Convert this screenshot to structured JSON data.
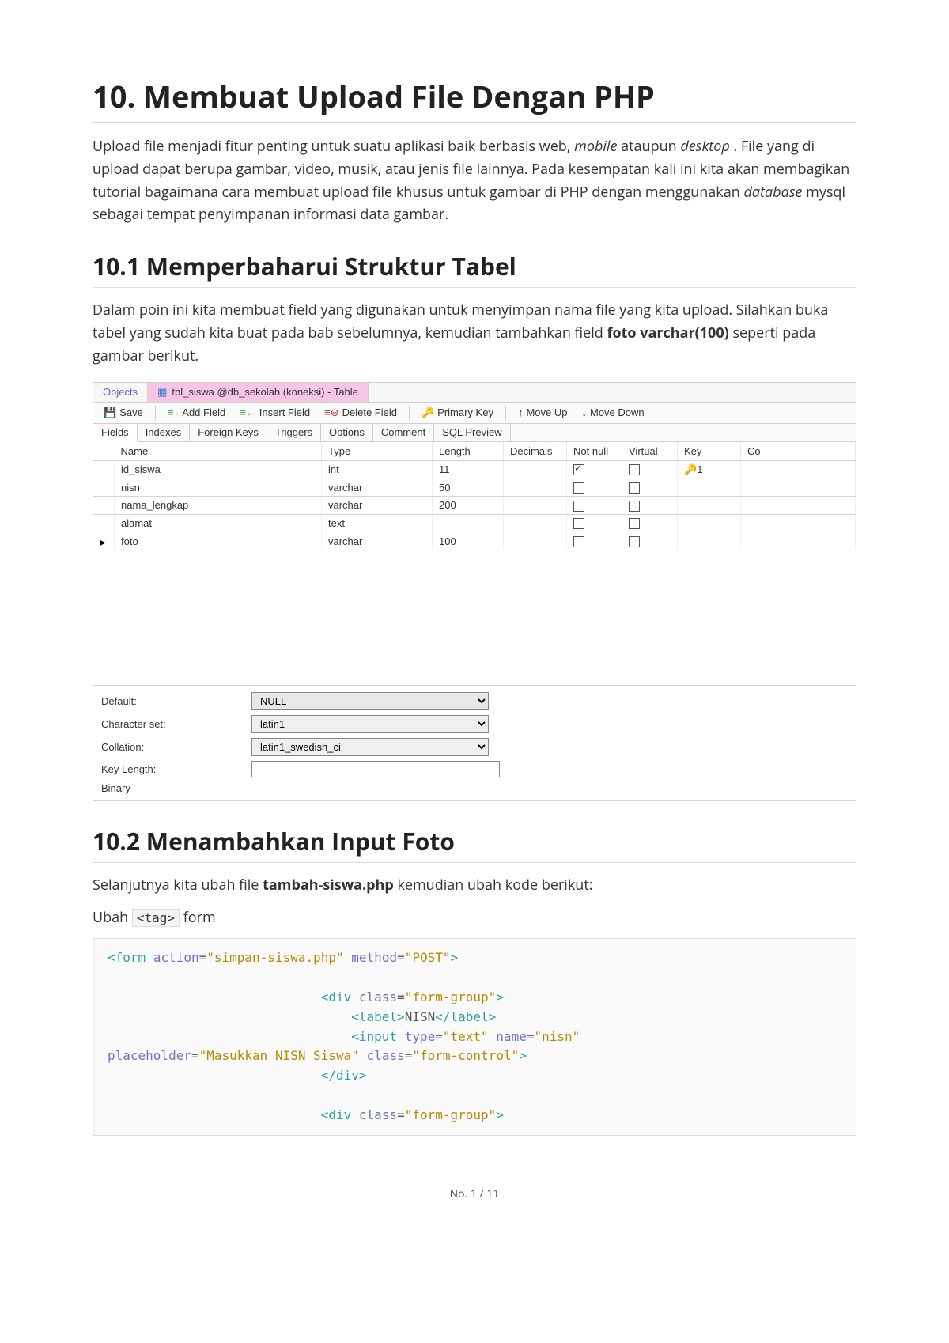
{
  "title": "10. Membuat Upload File Dengan PHP",
  "intro_chunks": [
    "Upload file menjadi fitur penting untuk suatu aplikasi baik berbasis web, ",
    "mobile",
    " ataupun ",
    "desktop",
    ". File yang di upload dapat berupa gambar, video, musik, atau jenis file lainnya. Pada kesempatan kali ini kita akan membagikan tutorial bagaimana cara membuat upload file khusus untuk gambar di PHP dengan menggunakan ",
    "database",
    " mysql sebagai tempat penyimpanan informasi data gambar."
  ],
  "sec1": {
    "title": "10.1 Memperbaharui Struktur Tabel",
    "para_a": "Dalam poin ini kita membuat field yang digunakan untuk menyimpan nama file yang kita upload. Silahkan buka tabel yang sudah kita buat pada bab sebelumnya, kemudian tambahkan field ",
    "bold": "foto varchar(100)",
    "para_b": " seperti pada gambar berikut."
  },
  "editor": {
    "tab_objects": "Objects",
    "tab_active": "tbl_siswa @db_sekolah (koneksi) - Table",
    "toolbar": {
      "save": "Save",
      "add": "Add Field",
      "insert": "Insert Field",
      "delete": "Delete Field",
      "pk": "Primary Key",
      "up": "Move Up",
      "down": "Move Down"
    },
    "subtabs": [
      "Fields",
      "Indexes",
      "Foreign Keys",
      "Triggers",
      "Options",
      "Comment",
      "SQL Preview"
    ],
    "columns": [
      "Name",
      "Type",
      "Length",
      "Decimals",
      "Not null",
      "Virtual",
      "Key",
      "Co"
    ],
    "rows": [
      {
        "name": "id_siswa",
        "type": "int",
        "length": "11",
        "decimals": "",
        "notnull": true,
        "virtual": false,
        "key": "1",
        "keyicon": true,
        "active": false
      },
      {
        "name": "nisn",
        "type": "varchar",
        "length": "50",
        "decimals": "",
        "notnull": false,
        "virtual": false,
        "key": "",
        "keyicon": false,
        "active": false
      },
      {
        "name": "nama_lengkap",
        "type": "varchar",
        "length": "200",
        "decimals": "",
        "notnull": false,
        "virtual": false,
        "key": "",
        "keyicon": false,
        "active": false
      },
      {
        "name": "alamat",
        "type": "text",
        "length": "",
        "decimals": "",
        "notnull": false,
        "virtual": false,
        "key": "",
        "keyicon": false,
        "active": false
      },
      {
        "name": "foto",
        "type": "varchar",
        "length": "100",
        "decimals": "",
        "notnull": false,
        "virtual": false,
        "key": "",
        "keyicon": false,
        "active": true
      }
    ],
    "props": {
      "default_label": "Default:",
      "default_value": "NULL",
      "charset_label": "Character set:",
      "charset_value": "latin1",
      "collation_label": "Collation:",
      "collation_value": "latin1_swedish_ci",
      "keylength_label": "Key Length:",
      "keylength_value": "",
      "binary_label": "Binary"
    }
  },
  "sec2": {
    "title": "10.2 Menambahkan Input Foto",
    "para_a": "Selanjutnya kita ubah file ",
    "bold": "tambah-siswa.php",
    "para_b": " kemudian ubah kode berikut:",
    "ubah": "Ubah ",
    "tag": "<tag>",
    "form": " form"
  },
  "code_lines": [
    [
      {
        "t": "tag",
        "v": "<form"
      },
      {
        "t": "txt",
        "v": " "
      },
      {
        "t": "attr",
        "v": "action"
      },
      {
        "t": "txt",
        "v": "="
      },
      {
        "t": "str",
        "v": "\"simpan-siswa.php\""
      },
      {
        "t": "txt",
        "v": " "
      },
      {
        "t": "attr",
        "v": "method"
      },
      {
        "t": "txt",
        "v": "="
      },
      {
        "t": "str",
        "v": "\"POST\""
      },
      {
        "t": "tag",
        "v": ">"
      }
    ],
    [],
    [
      {
        "t": "txt",
        "v": "                            "
      },
      {
        "t": "tag",
        "v": "<div"
      },
      {
        "t": "txt",
        "v": " "
      },
      {
        "t": "attr",
        "v": "class"
      },
      {
        "t": "txt",
        "v": "="
      },
      {
        "t": "str",
        "v": "\"form-group\""
      },
      {
        "t": "tag",
        "v": ">"
      }
    ],
    [
      {
        "t": "txt",
        "v": "                                "
      },
      {
        "t": "tag",
        "v": "<label>"
      },
      {
        "t": "txt",
        "v": "NISN"
      },
      {
        "t": "tag",
        "v": "</label>"
      }
    ],
    [
      {
        "t": "txt",
        "v": "                                "
      },
      {
        "t": "tag",
        "v": "<input"
      },
      {
        "t": "txt",
        "v": " "
      },
      {
        "t": "attr",
        "v": "type"
      },
      {
        "t": "txt",
        "v": "="
      },
      {
        "t": "str",
        "v": "\"text\""
      },
      {
        "t": "txt",
        "v": " "
      },
      {
        "t": "attr",
        "v": "name"
      },
      {
        "t": "txt",
        "v": "="
      },
      {
        "t": "str",
        "v": "\"nisn\""
      }
    ],
    [
      {
        "t": "attr",
        "v": "placeholder"
      },
      {
        "t": "txt",
        "v": "="
      },
      {
        "t": "str",
        "v": "\"Masukkan NISN Siswa\""
      },
      {
        "t": "txt",
        "v": " "
      },
      {
        "t": "attr",
        "v": "class"
      },
      {
        "t": "txt",
        "v": "="
      },
      {
        "t": "str",
        "v": "\"form-control\""
      },
      {
        "t": "tag",
        "v": ">"
      }
    ],
    [
      {
        "t": "txt",
        "v": "                            "
      },
      {
        "t": "tag",
        "v": "</div>"
      }
    ],
    [],
    [
      {
        "t": "txt",
        "v": "                            "
      },
      {
        "t": "tag",
        "v": "<div"
      },
      {
        "t": "txt",
        "v": " "
      },
      {
        "t": "attr",
        "v": "class"
      },
      {
        "t": "txt",
        "v": "="
      },
      {
        "t": "str",
        "v": "\"form-group\""
      },
      {
        "t": "tag",
        "v": ">"
      }
    ]
  ],
  "footer": "No. 1 / 11"
}
